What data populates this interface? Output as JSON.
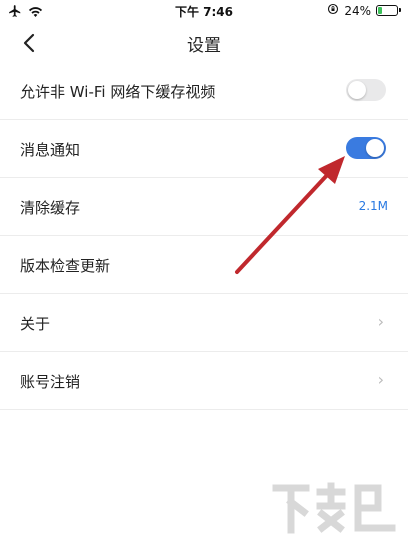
{
  "status_bar": {
    "time": "下午 7:46",
    "battery": "24%",
    "battery_level": 0.24,
    "icons": [
      "airplane-icon",
      "wifi-icon",
      "orientation-lock-icon",
      "battery-icon"
    ]
  },
  "nav": {
    "title": "设置",
    "back_icon": "chevron-left-icon"
  },
  "settings": [
    {
      "label": "允许非 Wi-Fi 网络下缓存视频",
      "control": "toggle",
      "on": false
    },
    {
      "label": "消息通知",
      "control": "toggle",
      "on": true
    },
    {
      "label": "清除缓存",
      "control": "value",
      "value": "2.1M"
    },
    {
      "label": "版本检查更新",
      "control": "none"
    },
    {
      "label": "关于",
      "control": "chevron"
    },
    {
      "label": "账号注销",
      "control": "chevron"
    }
  ],
  "colors": {
    "toggle_on": "#3a7be0",
    "toggle_off": "#e9e9ea",
    "accent_value": "#2a7ae2",
    "annotation_arrow": "#c0282d"
  },
  "annotation": {
    "type": "arrow",
    "icon": "red-arrow-icon"
  },
  "watermark": {
    "text": "下载吧"
  }
}
